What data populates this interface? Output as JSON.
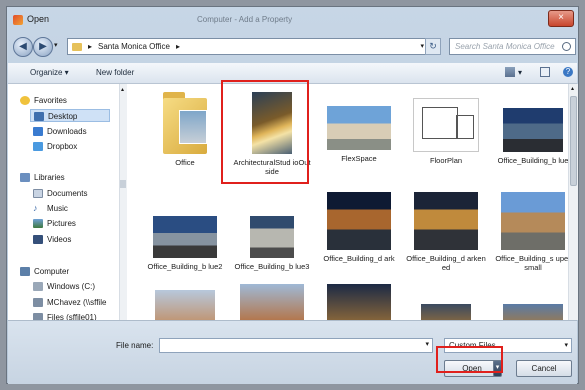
{
  "window": {
    "title": "Open",
    "ghost_title": "Computer - Add a Property",
    "close_glyph": "×"
  },
  "address": {
    "breadcrumb": "Santa Monica Office",
    "sep": "▸",
    "dropdown": "▾"
  },
  "search": {
    "placeholder": "Search Santa Monica Office"
  },
  "toolbar": {
    "organize": "Organize ▾",
    "new_folder": "New folder"
  },
  "nav": {
    "favorites": "Favorites",
    "desktop": "Desktop",
    "downloads": "Downloads",
    "dropbox": "Dropbox",
    "libraries": "Libraries",
    "documents": "Documents",
    "music": "Music",
    "pictures": "Pictures",
    "videos": "Videos",
    "computer": "Computer",
    "windows_c": "Windows (C:)",
    "mchavez": "MChavez (\\\\sffile",
    "files": "Files (sffile01)"
  },
  "files": [
    {
      "label": "Office"
    },
    {
      "label": "ArchitecturalStud ioOutside"
    },
    {
      "label": "FlexSpace"
    },
    {
      "label": "FloorPlan"
    },
    {
      "label": "Office_Building_b lue"
    },
    {
      "label": "Office_Building_b lue2"
    },
    {
      "label": "Office_Building_b lue3"
    },
    {
      "label": "Office_Building_d ark"
    },
    {
      "label": "Office_Building_d arkened"
    },
    {
      "label": "Office_Building_s uper small"
    }
  ],
  "bottom": {
    "filename_label": "File name:",
    "filter_value": "Custom Files",
    "open_label": "Open",
    "cancel_label": "Cancel"
  },
  "colors": {
    "selection_highlight": "#e0201c",
    "folder": "#e6c15a"
  }
}
